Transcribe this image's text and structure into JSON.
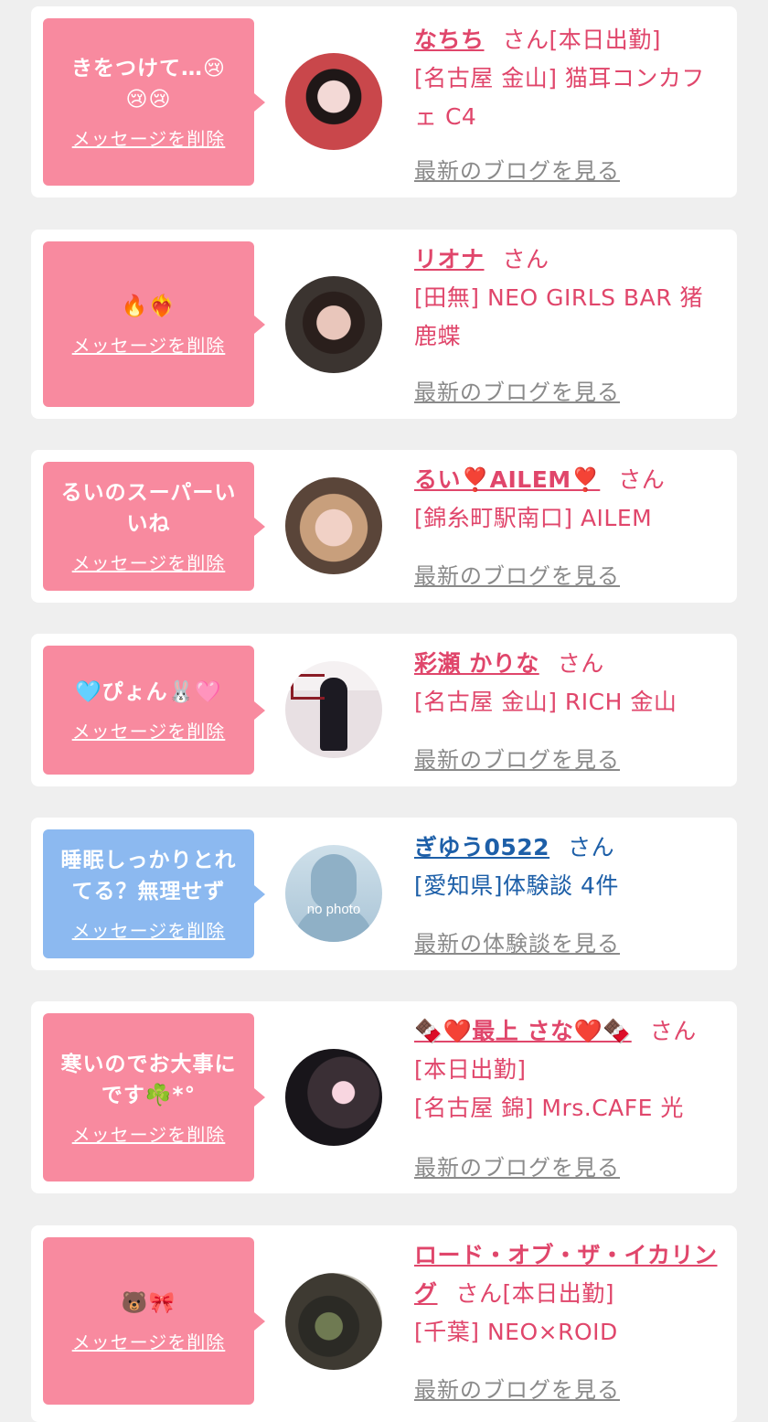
{
  "delete_label": "メッセージを削除",
  "cards": [
    {
      "message": "きをつけて…😢\n😢😢",
      "name": "なちち",
      "san": "さん",
      "status": "[本日出勤]",
      "shop": "[名古屋 金山] 猫耳コンカフェ C4",
      "link": "最新のブログを見る",
      "theme": "pink"
    },
    {
      "message": "🔥❤️‍🔥",
      "name": "リオナ",
      "san": "さん",
      "status": "",
      "shop": "[田無] NEO GIRLS BAR 猪鹿蝶",
      "link": "最新のブログを見る",
      "theme": "pink"
    },
    {
      "message": "るいのスーパーいいね",
      "name": "るい❣️AILEM❣️",
      "san": "さん",
      "status": "",
      "shop": "[錦糸町駅南口] AILEM",
      "link": "最新のブログを見る",
      "theme": "pink"
    },
    {
      "message": "🩵ぴょん🐰🩷",
      "name": "彩瀬 かりな",
      "san": "さん",
      "status": "",
      "shop": "[名古屋 金山] RICH 金山",
      "link": "最新のブログを見る",
      "theme": "pink"
    },
    {
      "message": "睡眠しっかりとれてる？無理せず",
      "name": "ぎゆう0522",
      "san": "さん",
      "status": "",
      "shop": "[愛知県]体験談 4件",
      "link": "最新の体験談を見る",
      "theme": "blue",
      "avatar_text": "no photo"
    },
    {
      "message": "寒いのでお大事にです☘️*°",
      "name": "🍫❤️最上 さな❤️🍫",
      "san": "さん",
      "status": "[本日出勤]",
      "shop": "[名古屋 錦] Mrs.CAFE 光",
      "link": "最新のブログを見る",
      "theme": "pink"
    },
    {
      "message": "🐻🎀",
      "name": "ロード・オブ・ザ・イカリング",
      "san": "さん",
      "status": "[本日出勤]",
      "shop": "[千葉] NEO×ROID",
      "link": "最新のブログを見る",
      "theme": "pink"
    }
  ]
}
